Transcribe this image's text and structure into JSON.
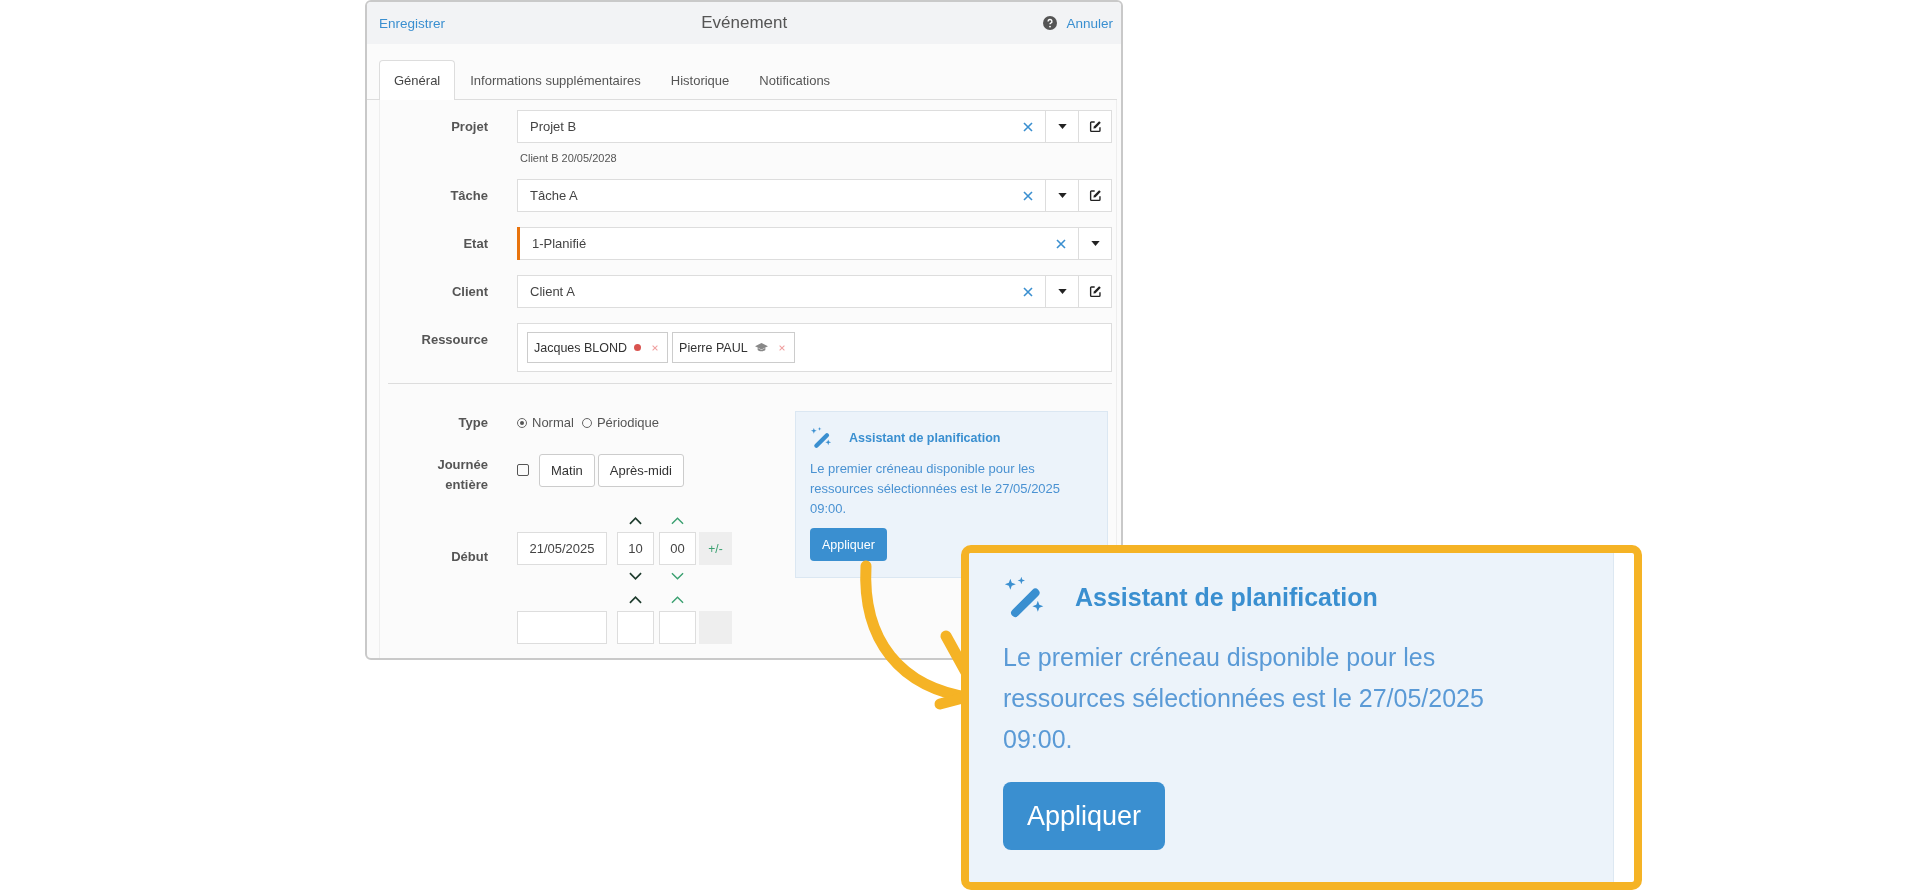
{
  "header": {
    "save": "Enregistrer",
    "title": "Evénement",
    "cancel": "Annuler"
  },
  "tabs": [
    {
      "label": "Général",
      "selected": true
    },
    {
      "label": "Informations supplémentaires",
      "selected": false
    },
    {
      "label": "Historique",
      "selected": false
    },
    {
      "label": "Notifications",
      "selected": false
    }
  ],
  "fields": [
    {
      "label": "Projet",
      "value": "Projet B",
      "editable": true,
      "hint": "Client B 20/05/2028"
    },
    {
      "label": "Tâche",
      "value": "Tâche A",
      "editable": true
    },
    {
      "label": "Etat",
      "value": "1-Planifié",
      "editable": false,
      "color": "#e8730c"
    },
    {
      "label": "Client",
      "value": "Client A",
      "editable": true
    }
  ],
  "resources": {
    "label": "Ressource",
    "tags": [
      {
        "name": "Jacques BLOND",
        "kind": "dot"
      },
      {
        "name": "Pierre PAUL",
        "kind": "trainee"
      }
    ]
  },
  "type": {
    "label": "Type",
    "options": [
      {
        "label": "Normal",
        "selected": true
      },
      {
        "label": "Périodique",
        "selected": false
      }
    ]
  },
  "all_day": {
    "label": "Journée entière",
    "checked": false,
    "buttons": [
      "Matin",
      "Après-midi"
    ]
  },
  "start": {
    "label": "Début",
    "date": "21/05/2025",
    "hour": "10",
    "minute": "00",
    "adjust": "+/-"
  },
  "assistant": {
    "title": "Assistant de planification",
    "message": "Le premier créneau disponible pour les ressources sélectionnées est le 27/05/2025 09:00.",
    "button": "Appliquer"
  },
  "callout": {
    "title": "Assistant de planification",
    "message": "Le premier créneau disponible pour les ressources sélectionnées est le 27/05/2025 09:00.",
    "button": "Appliquer"
  }
}
